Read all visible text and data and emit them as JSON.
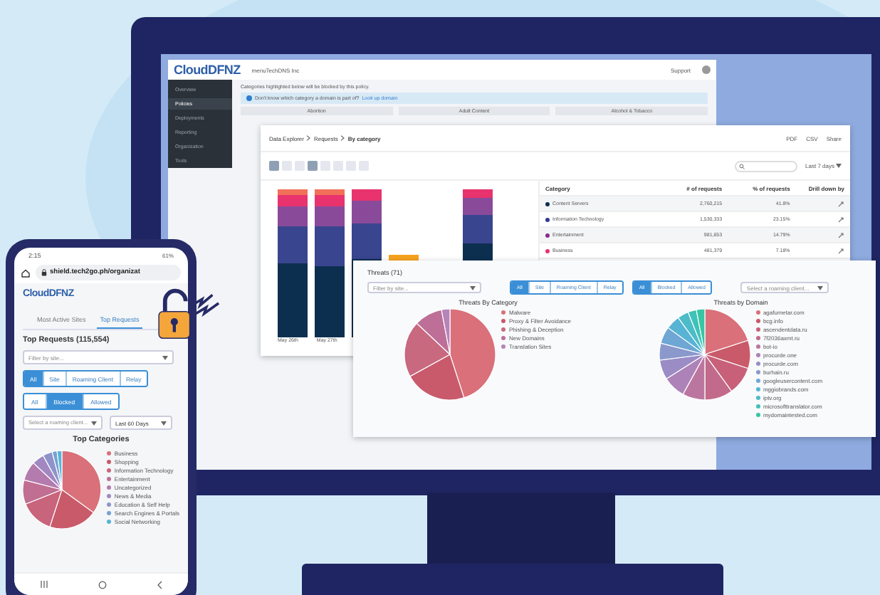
{
  "back_app": {
    "logo": "CloudDFNZ",
    "org": "menuTechDNS Inc",
    "support": "Support",
    "nav": [
      {
        "label": "Overview",
        "selected": false
      },
      {
        "label": "Policies",
        "selected": true
      },
      {
        "label": "Deployments",
        "selected": false
      },
      {
        "label": "Reporting",
        "selected": false
      },
      {
        "label": "Organization",
        "selected": false
      },
      {
        "label": "Tools",
        "selected": false
      }
    ],
    "description": "Categories highlighted below will be blocked by this policy.",
    "notice": "Don't know which category a domain is part of?",
    "notice_link": "Look up domain",
    "categories": [
      "Abortion",
      "Adult Content",
      "Alcohol & Tobacco"
    ]
  },
  "explorer": {
    "breadcrumbs": [
      "Data Explorer",
      "Requests",
      "By category"
    ],
    "actions": [
      "PDF",
      "CSV",
      "Share"
    ],
    "date_range": "Last 7 days",
    "bar_labels": [
      "May 26th",
      "May 27th"
    ],
    "columns": [
      "Category",
      "# of requests",
      "% of requests",
      "Drill down by"
    ],
    "rows": [
      {
        "category": "Content Servers",
        "requests": "2,760,215",
        "percent": "41.8%",
        "color": "#0d2f4f"
      },
      {
        "category": "Information Technology",
        "requests": "1,530,333",
        "percent": "23.15%",
        "color": "#343a8c"
      },
      {
        "category": "Entertainment",
        "requests": "981,653",
        "percent": "14.79%",
        "color": "#8a2c8e"
      },
      {
        "category": "Business",
        "requests": "481,379",
        "percent": "7.18%",
        "color": "#e8336e"
      }
    ]
  },
  "threats": {
    "title": "Threats (71)",
    "site_filter": {
      "placeholder": "Filter by site..."
    },
    "scope_tabs": [
      {
        "label": "All",
        "selected": true
      },
      {
        "label": "Site",
        "selected": false
      },
      {
        "label": "Roaming Client",
        "selected": false
      },
      {
        "label": "Relay",
        "selected": false
      }
    ],
    "status_tabs": [
      {
        "label": "All",
        "selected": true
      },
      {
        "label": "Blocked",
        "selected": false
      },
      {
        "label": "Allowed",
        "selected": false
      }
    ],
    "client_filter": {
      "placeholder": "Select a roaming client..."
    },
    "category_chart": {
      "title": "Threats By Category",
      "legend": [
        {
          "label": "Malware",
          "color": "#d9707a"
        },
        {
          "label": "Proxy & Filter Avoidance",
          "color": "#c85a6c"
        },
        {
          "label": "Phishing & Deception",
          "color": "#c8697f"
        },
        {
          "label": "New Domains",
          "color": "#bd6f98"
        },
        {
          "label": "Translation Sites",
          "color": "#b684b8"
        }
      ]
    },
    "domain_chart": {
      "title": "Threats by Domain",
      "legend": [
        {
          "label": "agafurnetar.com",
          "color": "#d9707a"
        },
        {
          "label": "bcg.info",
          "color": "#c95a6a"
        },
        {
          "label": "ascendentdata.ru",
          "color": "#c8607a"
        },
        {
          "label": "7f2036axmt.ru",
          "color": "#c26a8a"
        },
        {
          "label": "bot-io",
          "color": "#bb76a0"
        },
        {
          "label": "procurde.one",
          "color": "#ad82b8"
        },
        {
          "label": "procurde.com",
          "color": "#9b8cc6"
        },
        {
          "label": "burhain.ru",
          "color": "#8a98cc"
        },
        {
          "label": "googleusercontent.com",
          "color": "#6ea6d4"
        },
        {
          "label": "mggiobrands.com",
          "color": "#58b4d4"
        },
        {
          "label": "iptv.org",
          "color": "#4cbcc8"
        },
        {
          "label": "microsofttranslator.com",
          "color": "#3fc2b8"
        },
        {
          "label": "mydomaintested.com",
          "color": "#36c6a4"
        }
      ]
    }
  },
  "phone": {
    "time": "2:15",
    "battery": "61%",
    "url": "shield.tech2go.ph/organizat",
    "logo": "CloudDFNZ",
    "tabs": [
      {
        "label": "Most Active Sites",
        "selected": false
      },
      {
        "label": "Top Requests",
        "selected": true
      }
    ],
    "title": "Top Requests (115,554)",
    "site_filter": {
      "placeholder": "Filter by site..."
    },
    "scope_tabs": [
      {
        "label": "All",
        "selected": true
      },
      {
        "label": "Site",
        "selected": false
      },
      {
        "label": "Roaming Client",
        "selected": false
      },
      {
        "label": "Relay",
        "selected": false
      }
    ],
    "status_tabs": [
      {
        "label": "All",
        "selected": false
      },
      {
        "label": "Blocked",
        "selected": true
      },
      {
        "label": "Allowed",
        "selected": false
      }
    ],
    "client_filter": {
      "placeholder": "Select a roaming client..."
    },
    "range": "Last 60 Days",
    "chart_title": "Top Categories",
    "legend": [
      {
        "label": "Business",
        "color": "#d9707a"
      },
      {
        "label": "Shopping",
        "color": "#c85a6a"
      },
      {
        "label": "Information Technology",
        "color": "#c8647c"
      },
      {
        "label": "Entertainment",
        "color": "#c06e92"
      },
      {
        "label": "Uncategorized",
        "color": "#b47cae"
      },
      {
        "label": "News & Media",
        "color": "#a288c2"
      },
      {
        "label": "Education & Self Help",
        "color": "#8e94ca"
      },
      {
        "label": "Search Engines & Portals",
        "color": "#74a2d2"
      },
      {
        "label": "Social Networking",
        "color": "#58b4d8"
      }
    ]
  }
}
